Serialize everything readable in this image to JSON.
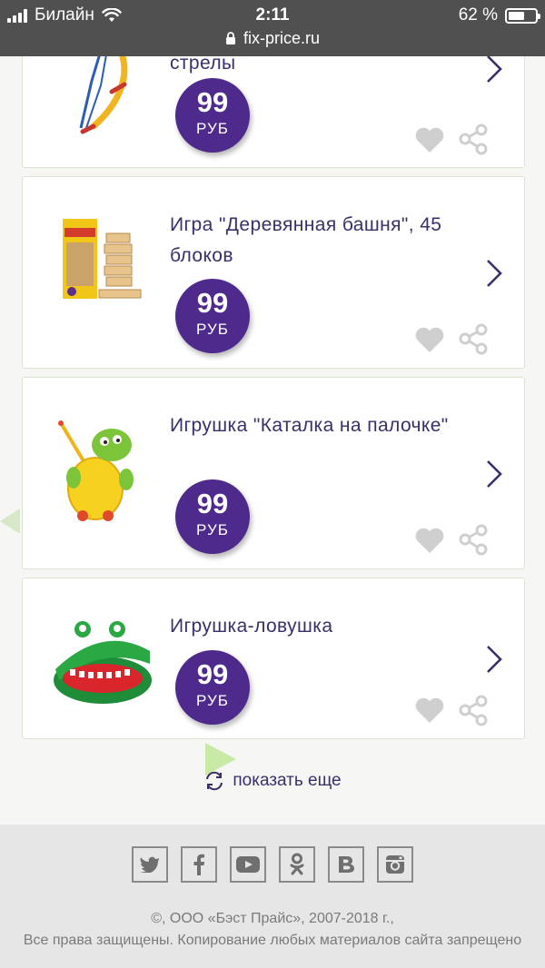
{
  "status": {
    "carrier": "Билайн",
    "time": "2:11",
    "battery": "62 %",
    "battery_level": 0.62,
    "url": "fix-price.ru"
  },
  "colors": {
    "accent": "#4f2a8d",
    "title": "#3a2f6b",
    "card_border": "#dbe6cf",
    "footer_bg": "#e6e6e6"
  },
  "products": [
    {
      "title": "стрелы",
      "price": "99",
      "currency": "РУБ"
    },
    {
      "title": "Игра \"Деревянная башня\", 45 блоков",
      "price": "99",
      "currency": "РУБ"
    },
    {
      "title": "Игрушка \"Каталка на палочке\"",
      "price": "99",
      "currency": "РУБ"
    },
    {
      "title": "Игрушка-ловушка",
      "price": "99",
      "currency": "РУБ"
    }
  ],
  "load_more": "показать еще",
  "social_icons": [
    "twitter-icon",
    "facebook-icon",
    "youtube-icon",
    "odnoklassniki-icon",
    "vk-icon",
    "instagram-icon"
  ],
  "footer": {
    "copyright": "©, ООО «Бэст Прайс», 2007-2018 г.,",
    "rights": "Все права защищены. Копирование любых материалов сайта запрещено"
  }
}
